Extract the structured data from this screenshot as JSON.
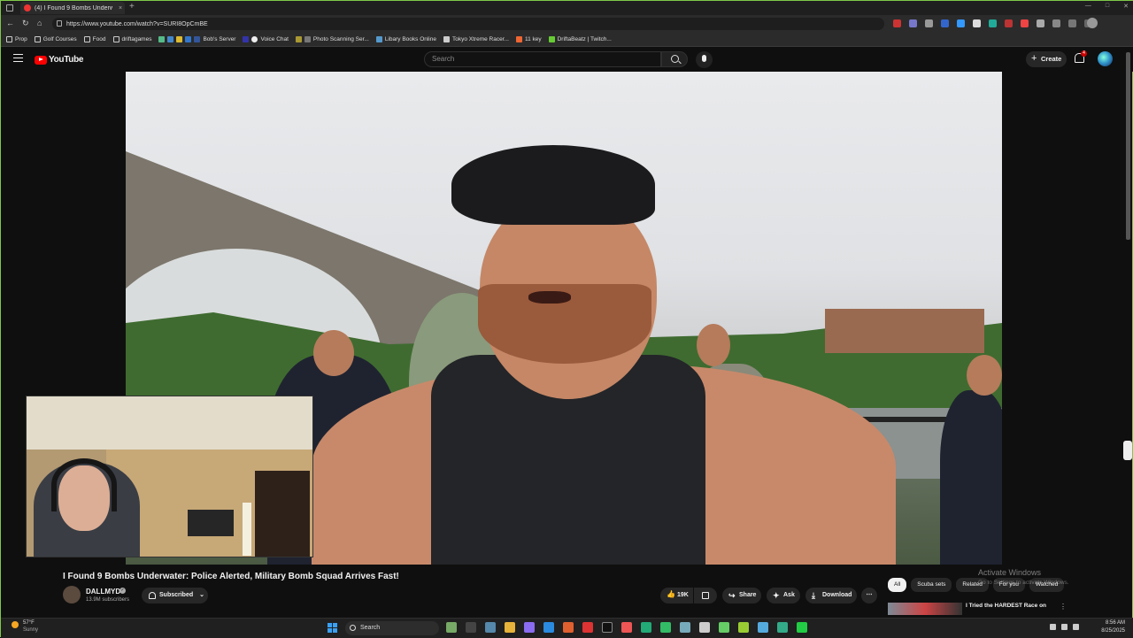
{
  "browser": {
    "tab_title": "(4) I Found 9 Bombs Underw",
    "url": "https://www.youtube.com/watch?v=SURI8OpCmBE",
    "bookmarks": [
      "Prop",
      "Golf Courses",
      "Food",
      "driftagames",
      "Bob's Server",
      "Voice Chat",
      "Photo Scanning Ser...",
      "Libary Books Online",
      "Tokyo Xtreme Racer...",
      "11 key",
      "DriftaBeatz | Twitch..."
    ],
    "colors": {
      "accent": "#7fc94a"
    }
  },
  "youtube": {
    "logo_text": "YouTube",
    "search_placeholder": "Search",
    "create_label": "Create",
    "notifications_count": "4"
  },
  "video": {
    "title": "I Found 9 Bombs Underwater: Police Alerted, Military Bomb Squad Arrives Fast!",
    "channel": "DALLMYD",
    "subscribers": "13.9M subscribers",
    "subscribed_label": "Subscribed",
    "likes": "19K",
    "share_label": "Share",
    "ask_label": "Ask",
    "download_label": "Download"
  },
  "sidebar": {
    "chips": [
      "All",
      "Scuba sets",
      "Related",
      "For you",
      "Watched"
    ],
    "rec_title": "I Tried the HARDEST Race on"
  },
  "watermark": {
    "line1": "Activate Windows",
    "line2": "Go to Settings to activate Windows."
  },
  "taskbar": {
    "weather_temp": "57°F",
    "weather_desc": "Sunny",
    "search_label": "Search",
    "time": "8:56 AM",
    "date": "8/25/2025"
  }
}
